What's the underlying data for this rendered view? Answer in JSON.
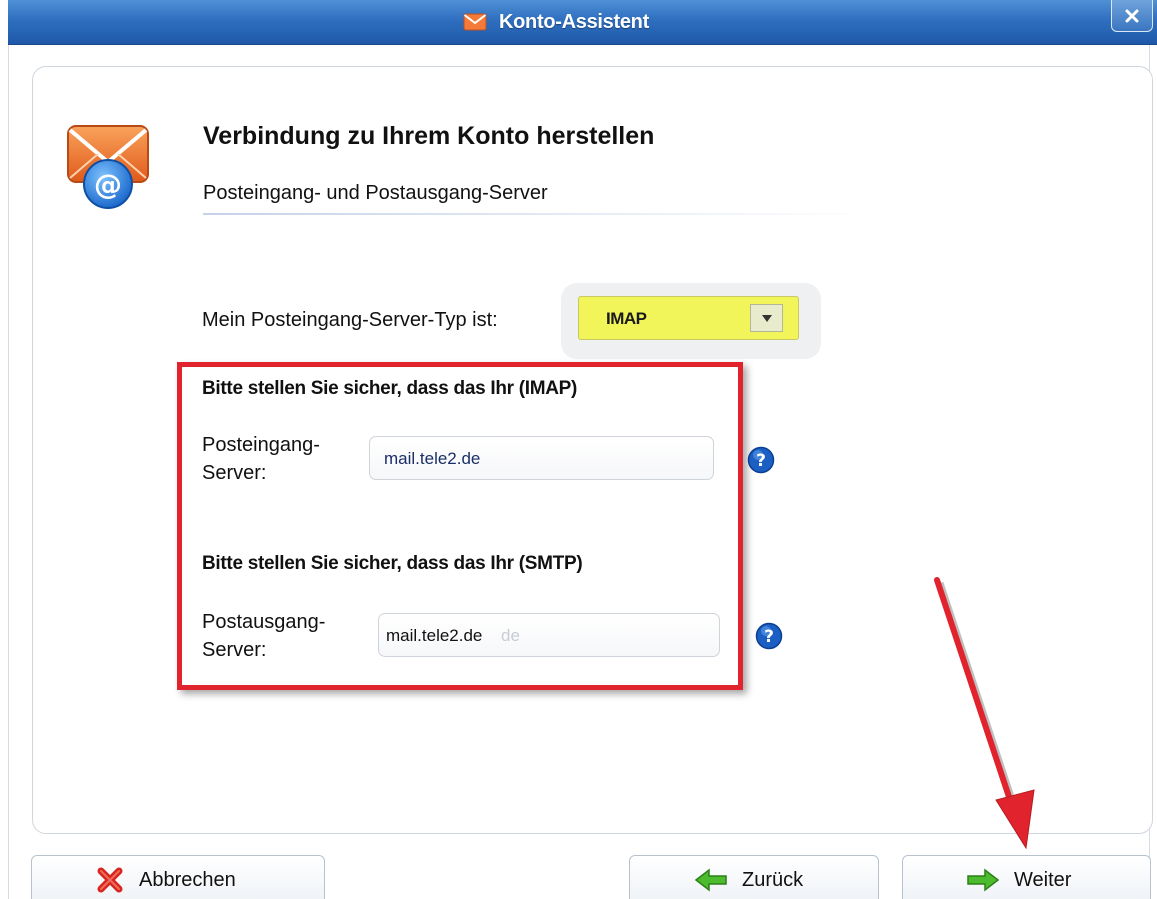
{
  "window": {
    "title": "Konto-Assistent",
    "icons": {
      "title": "envelope-icon",
      "close": "close-icon"
    }
  },
  "header": {
    "icon": "mail-at-icon",
    "title": "Verbindung zu Ihrem Konto herstellen",
    "subtitle": "Posteingang- und Postausgang-Server"
  },
  "server_type": {
    "label": "Mein Posteingang-Server-Typ ist:",
    "selected": "IMAP",
    "highlight_color": "#f2f55a"
  },
  "incoming": {
    "section_title": "Bitte stellen Sie sicher, dass das Ihr (IMAP)",
    "label_line1": "Posteingang-",
    "label_line2": "Server:",
    "value": "mail.tele2.de",
    "help_icon": "help-icon"
  },
  "outgoing": {
    "section_title": "Bitte stellen Sie sicher, dass das Ihr (SMTP)",
    "label_line1": "Postausgang-",
    "label_line2": "Server:",
    "value": "mail.tele2.de",
    "ghost_text": "de",
    "help_icon": "help-icon"
  },
  "buttons": {
    "cancel": "Abbrechen",
    "back": "Zurück",
    "next": "Weiter"
  },
  "annotation": {
    "highlight_color": "#e0232d"
  }
}
